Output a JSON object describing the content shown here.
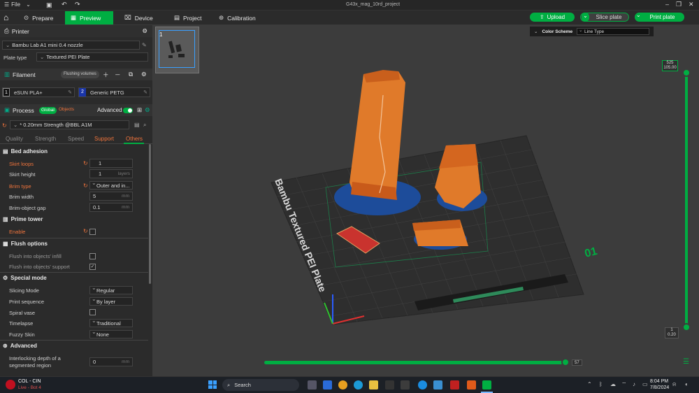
{
  "titlebar": {
    "file_label": "File",
    "doc_title": "G43x_mag_10rd_project"
  },
  "tabs": [
    {
      "label": "Prepare"
    },
    {
      "label": "Preview"
    },
    {
      "label": "Device"
    },
    {
      "label": "Project"
    },
    {
      "label": "Calibration"
    }
  ],
  "actions": {
    "upload": "Upload",
    "slice": "Slice plate",
    "print": "Print plate"
  },
  "printer": {
    "section_label": "Printer",
    "model": "Bambu Lab A1 mini 0.4 nozzle",
    "plate_type_label": "Plate type",
    "plate_type": "Textured PEI Plate"
  },
  "filament": {
    "section_label": "Filament",
    "flushing_label": "Flushing volumes",
    "slots": [
      {
        "index": "1",
        "name": "eSUN PLA+"
      },
      {
        "index": "2",
        "name": "Generic PETG"
      }
    ]
  },
  "process": {
    "section_label": "Process",
    "global_label": "Global",
    "objects_label": "Objects",
    "advanced_label": "Advanced",
    "preset": "* 0.20mm Strength @BBL A1M",
    "subtabs": [
      "Quality",
      "Strength",
      "Speed",
      "Support",
      "Others"
    ]
  },
  "bed_adhesion": {
    "title": "Bed adhesion",
    "skirt_loops_label": "Skirt loops",
    "skirt_loops": "1",
    "skirt_height_label": "Skirt height",
    "skirt_height": "1",
    "skirt_height_unit": "layers",
    "brim_type_label": "Brim type",
    "brim_type": "Outer and in...",
    "brim_width_label": "Brim width",
    "brim_width": "5",
    "brim_width_unit": "mm",
    "brim_gap_label": "Brim-object gap",
    "brim_gap": "0.1",
    "brim_gap_unit": "mm"
  },
  "prime_tower": {
    "title": "Prime tower",
    "enable_label": "Enable"
  },
  "flush_options": {
    "title": "Flush options",
    "infill_label": "Flush into objects' infill",
    "support_label": "Flush into objects' support"
  },
  "special_mode": {
    "title": "Special mode",
    "slicing_label": "Slicing Mode",
    "slicing": "Regular",
    "sequence_label": "Print sequence",
    "sequence": "By layer",
    "spiral_label": "Spiral vase",
    "timelapse_label": "Timelapse",
    "timelapse": "Traditional",
    "fuzzy_label": "Fuzzy Skin",
    "fuzzy": "None"
  },
  "advanced": {
    "title": "Advanced",
    "interlock_label": "Interlocking depth of a segmented region",
    "interlock": "0",
    "interlock_unit": "mm"
  },
  "viewport": {
    "plate_number": "1",
    "color_scheme_label": "Color Scheme",
    "color_scheme": "Line Type",
    "plate_text": "Bambu Textured PEI Plate",
    "plate_id": "01",
    "layer_top_num": "525",
    "layer_top_height": "105.00",
    "layer_bottom_num": "1",
    "layer_bottom_height": "0.20",
    "move_value": "57"
  },
  "taskbar": {
    "weather_title": "COL - CIN",
    "weather_sub": "Live - Bot 4",
    "search": "Search",
    "time": "8:04 PM",
    "date": "7/8/2024"
  },
  "colors": {
    "accent": "#00ae42",
    "model": "#e07a2a",
    "brim": "#1f4e9e",
    "orange_label": "#f0743c"
  }
}
